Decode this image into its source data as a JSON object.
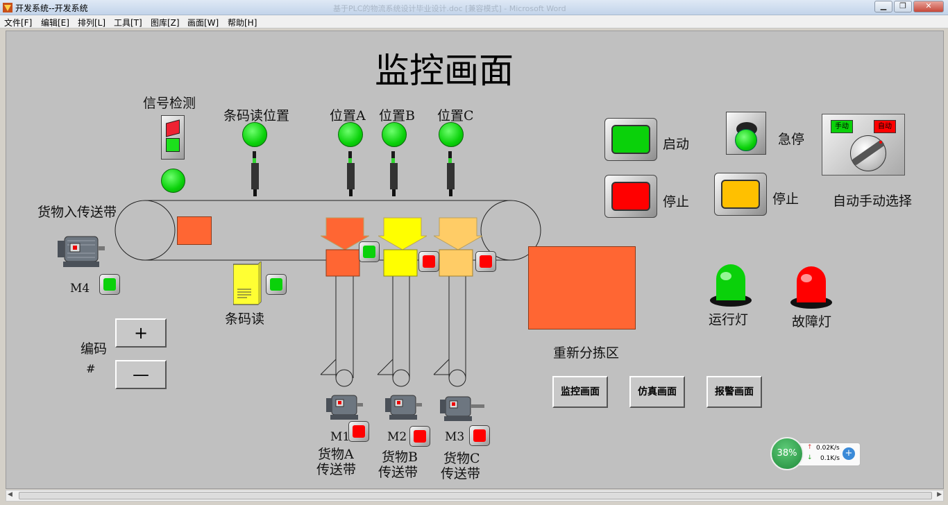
{
  "window": {
    "title": "开发系统--开发系统",
    "ghost_title": "基于PLC的物流系统设计毕业设计.doc [兼容模式] - Microsoft Word",
    "min_icon": "minimize-icon",
    "max_icon": "restore-icon",
    "close_icon": "close-icon"
  },
  "menu": [
    "文件[F]",
    "编辑[E]",
    "排列[L]",
    "工具[T]",
    "图库[Z]",
    "画面[W]",
    "帮助[H]"
  ],
  "page": {
    "title": "监控画面",
    "signal_detect": "信号检测",
    "barcode_read_pos": "条码读位置",
    "pos_a": "位置A",
    "pos_b": "位置B",
    "pos_c": "位置C",
    "cargo_in_belt": "货物入传送带",
    "m4": "M4",
    "barcode_reader": "条码读",
    "encode": "编码",
    "hash": "#",
    "plus": "+",
    "minus": "—",
    "m1": "M1",
    "m2": "M2",
    "m3": "M3",
    "belt_a_1": "货物A",
    "belt_a_2": "传送带",
    "belt_b_1": "货物B",
    "belt_b_2": "传送带",
    "belt_c_1": "货物C",
    "belt_c_2": "传送带",
    "resort_area": "重新分拣区",
    "start": "启动",
    "stop": "停止",
    "estop": "急停",
    "stop2": "停止",
    "auto_manual": "自动手动选择",
    "manual": "手动",
    "auto": "自动",
    "run_lamp": "运行灯",
    "fault_lamp": "故障灯",
    "nav_monitor": "监控画面",
    "nav_sim": "仿真画面",
    "nav_alarm": "报警画面"
  },
  "net": {
    "percent": "38%",
    "up": "0.02K/s",
    "down": "0.1K/s"
  },
  "colors": {
    "green": "#0ad10a",
    "red": "#ff0000",
    "orange": "#ff6633",
    "yellow": "#ffff00",
    "peach": "#ffcc66",
    "amber": "#ffc000"
  }
}
